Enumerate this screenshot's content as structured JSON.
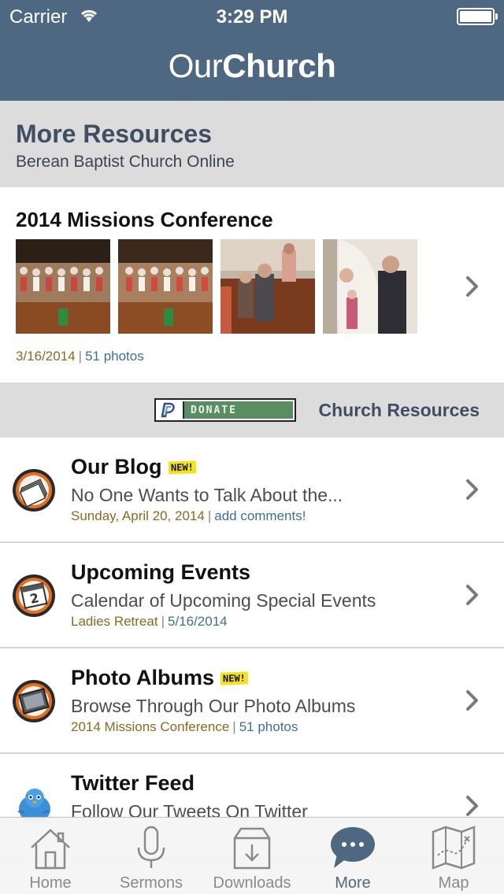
{
  "status_bar": {
    "carrier": "Carrier",
    "time": "3:29 PM"
  },
  "brand": {
    "our": "Our",
    "church": "Church"
  },
  "page": {
    "title": "More Resources",
    "subtitle": "Berean Baptist Church Online"
  },
  "album": {
    "title": "2014 Missions Conference",
    "date": "3/16/2014",
    "separator": "|",
    "count": "51 photos"
  },
  "resources_bar": {
    "donate_label": "DONATE",
    "label": "Church Resources"
  },
  "list": [
    {
      "title": "Our Blog",
      "badge": "NEW!",
      "subtitle": "No One Wants to Talk About the...",
      "meta_left": "Sunday, April 20, 2014",
      "meta_sep": "|",
      "meta_right": "add comments!",
      "icon": "paper-stack-icon"
    },
    {
      "title": "Upcoming Events",
      "badge": "",
      "subtitle": "Calendar of Upcoming Special Events",
      "meta_left": "Ladies Retreat",
      "meta_sep": "|",
      "meta_right": "5/16/2014",
      "icon": "calendar-icon"
    },
    {
      "title": "Photo Albums",
      "badge": "NEW!",
      "subtitle": "Browse Through Our Photo Albums",
      "meta_left": "2014 Missions Conference",
      "meta_sep": "|",
      "meta_right": "51 photos",
      "icon": "photo-frame-icon"
    },
    {
      "title": "Twitter Feed",
      "badge": "",
      "subtitle": "Follow Our Tweets On Twitter",
      "meta_left": "",
      "meta_sep": "",
      "meta_right": "",
      "icon": "twitter-bird-icon"
    }
  ],
  "tabs": [
    {
      "label": "Home",
      "icon": "home-icon"
    },
    {
      "label": "Sermons",
      "icon": "microphone-icon"
    },
    {
      "label": "Downloads",
      "icon": "download-box-icon"
    },
    {
      "label": "More",
      "icon": "chat-bubble-icon",
      "active": true
    },
    {
      "label": "Map",
      "icon": "map-icon"
    }
  ],
  "colors": {
    "header": "#4e6882",
    "accent_date": "#8a6a1f",
    "accent_link": "#3d6f9c",
    "section_bg": "#dcdcdc"
  }
}
